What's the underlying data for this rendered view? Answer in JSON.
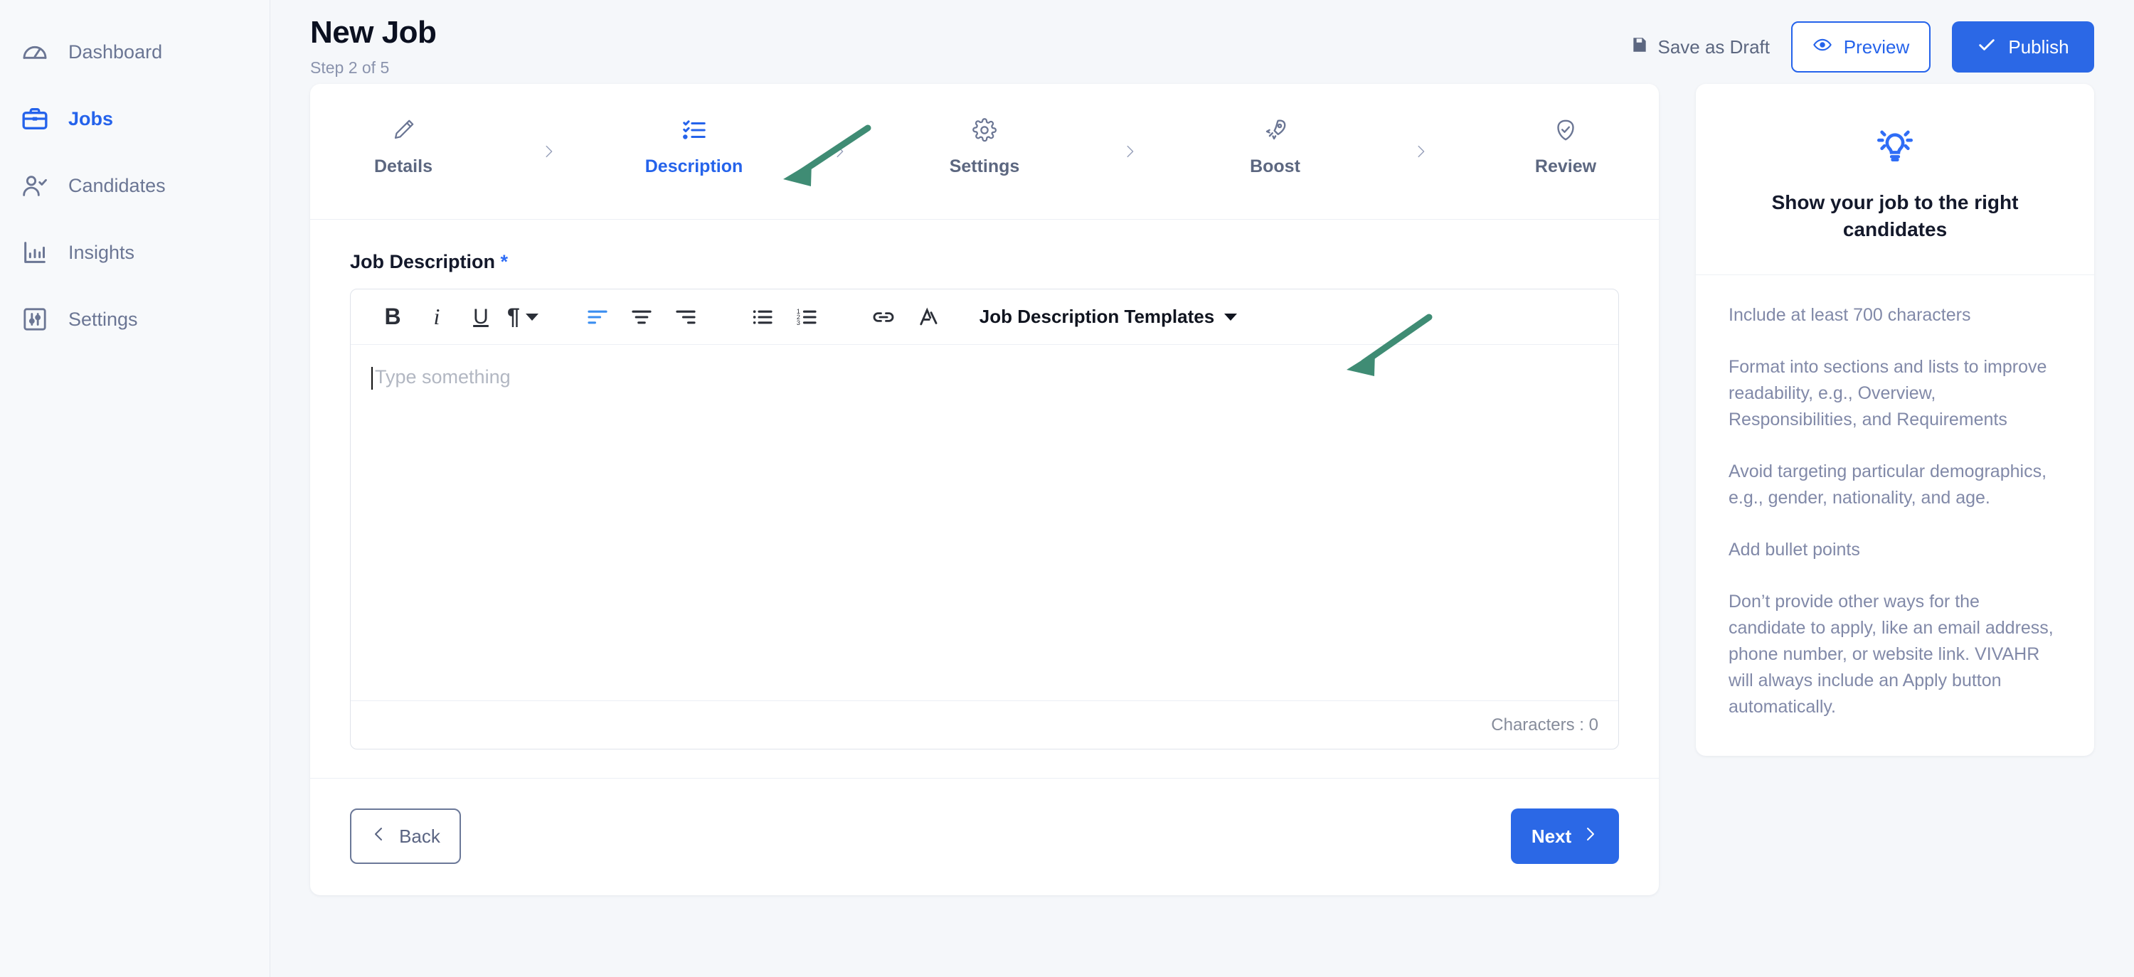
{
  "sidebar": {
    "items": [
      {
        "label": "Dashboard",
        "icon": "gauge-icon",
        "active": false
      },
      {
        "label": "Jobs",
        "icon": "briefcase-icon",
        "active": true
      },
      {
        "label": "Candidates",
        "icon": "user-check-icon",
        "active": false
      },
      {
        "label": "Insights",
        "icon": "bar-chart-icon",
        "active": false
      },
      {
        "label": "Settings",
        "icon": "sliders-icon",
        "active": false
      }
    ]
  },
  "header": {
    "title": "New Job",
    "step_text": "Step 2 of 5",
    "save_draft_label": "Save as Draft",
    "preview_label": "Preview",
    "publish_label": "Publish"
  },
  "wizard": {
    "steps": [
      {
        "label": "Details",
        "icon": "pen-icon",
        "active": false
      },
      {
        "label": "Description",
        "icon": "checklist-icon",
        "active": true
      },
      {
        "label": "Settings",
        "icon": "gear-icon",
        "active": false
      },
      {
        "label": "Boost",
        "icon": "rocket-icon",
        "active": false
      },
      {
        "label": "Review",
        "icon": "check-circle-icon",
        "active": false
      }
    ]
  },
  "form": {
    "field_label": "Job Description",
    "required_marker": "*",
    "editor": {
      "placeholder": "Type something",
      "value": "",
      "character_count_label": "Characters : 0",
      "toolbar": {
        "bold": "B",
        "italic": "i",
        "underline": "U",
        "paragraph": "¶",
        "templates_label": "Job Description Templates",
        "active_button": "align-left"
      }
    }
  },
  "footer": {
    "back_label": "Back",
    "next_label": "Next"
  },
  "tips": {
    "title": "Show your job to the right candidates",
    "icon": "lightbulb-icon",
    "items": [
      "Include at least 700 characters",
      "Format into sections and lists to improve readability, e.g., Overview, Responsibilities, and Requirements",
      "Avoid targeting particular demographics, e.g., gender, nationality, and age.",
      "Add bullet points",
      "Don’t provide other ways for the candidate to apply, like an email address, phone number, or website link. VIVAHR will always include an Apply button automatically."
    ]
  },
  "colors": {
    "accent_blue": "#2563eb",
    "publish_blue": "#2b68e6",
    "muted_text": "#8189a8",
    "annotation_green": "#3f8c74",
    "page_bg": "#f5f7fa"
  },
  "annotations": [
    {
      "name": "arrow-to-description-step",
      "target": "wizard step Description"
    },
    {
      "name": "arrow-to-templates-dropdown",
      "target": "Job Description Templates dropdown"
    }
  ]
}
